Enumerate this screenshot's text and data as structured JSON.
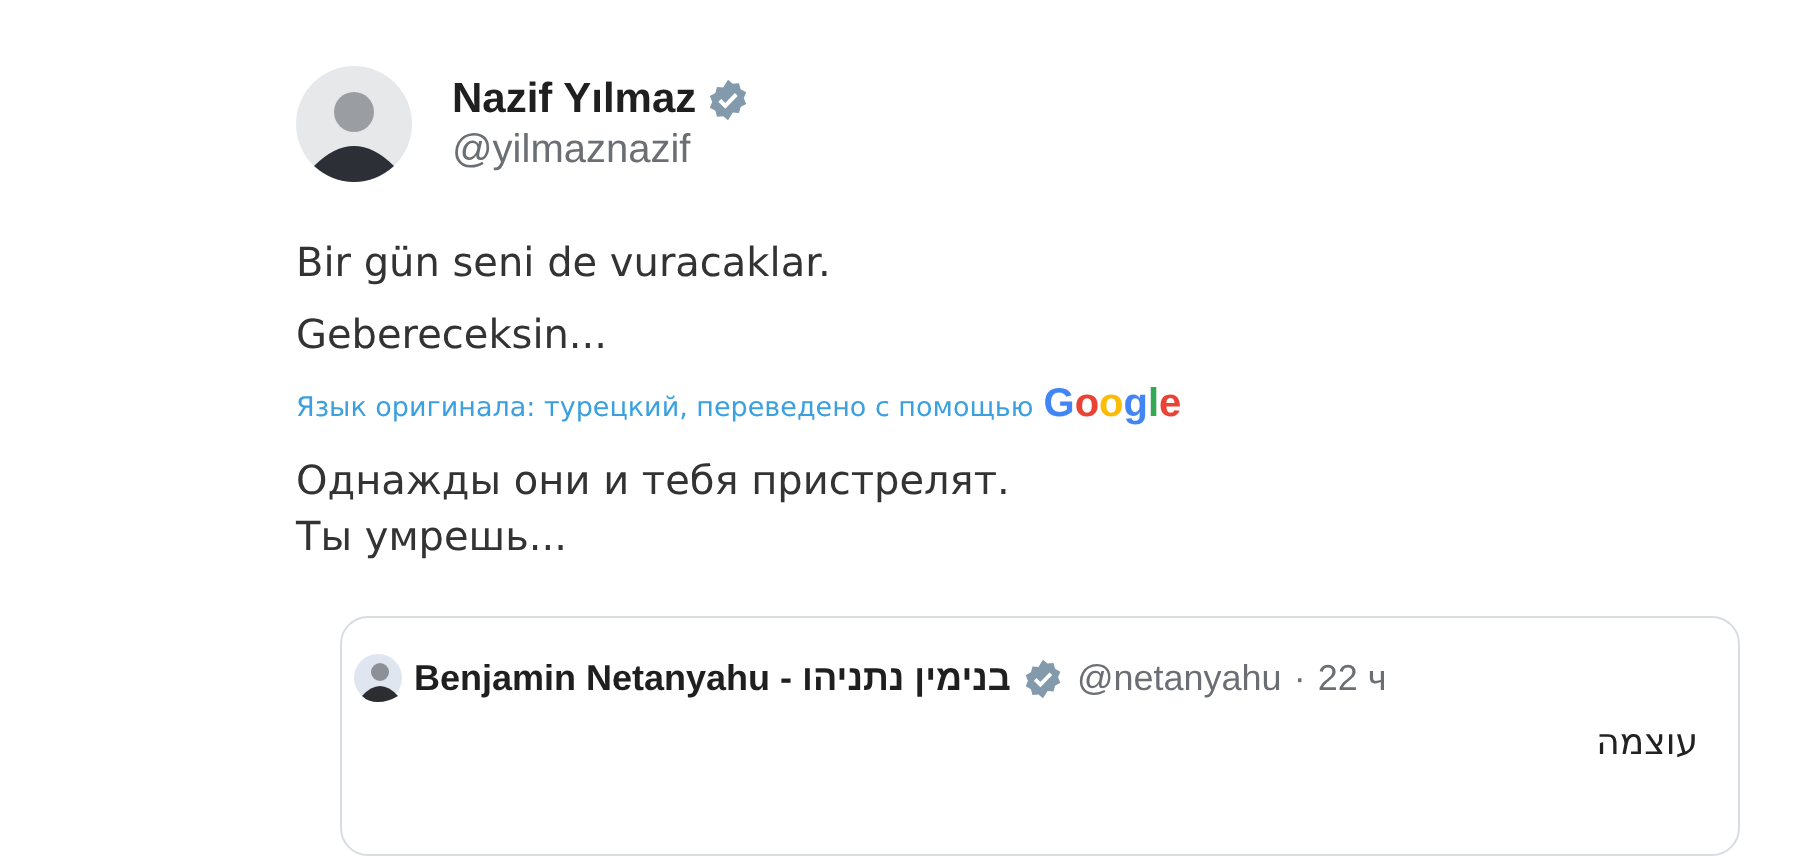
{
  "author": {
    "name": "Nazif Yılmaz",
    "handle": "@yilmaznazif",
    "verified": true
  },
  "text_lines": [
    "Bir gün seni de vuracaklar.",
    "Gebereceksin..."
  ],
  "translation": {
    "note": "Язык оригинала: турецкий, переведено с помощью",
    "provider": "Google",
    "lines": [
      "Однажды они и тебя пристрелят.",
      "Ты умрешь..."
    ]
  },
  "quoted_tweet": {
    "name": "Benjamin Netanyahu - בנימין נתניהו",
    "verified": true,
    "handle": "@netanyahu",
    "separator": "·",
    "time": "22 ч",
    "text": "עוצמה"
  }
}
